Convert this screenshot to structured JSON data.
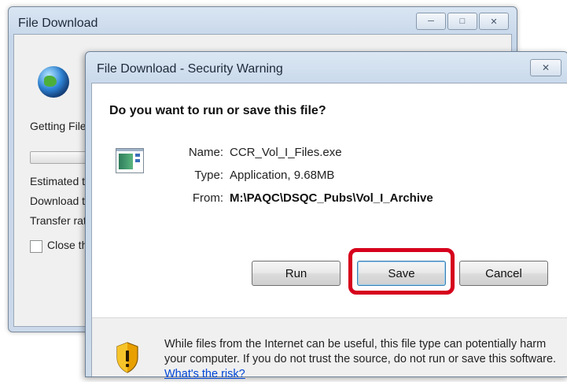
{
  "back_window": {
    "title": "File Download",
    "status_text": "Getting File",
    "estimated_label": "Estimated t",
    "download_label": "Download t",
    "transfer_label": "Transfer rat",
    "close_checkbox_label": "Close th"
  },
  "dialog": {
    "title": "File Download - Security Warning",
    "question": "Do you want to run or save this file?",
    "name_label": "Name:",
    "name_value": "CCR_Vol_I_Files.exe",
    "type_label": "Type:",
    "type_value": "Application, 9.68MB",
    "from_label": "From:",
    "from_value": "M:\\PAQC\\DSQC_Pubs\\Vol_I_Archive",
    "buttons": {
      "run": "Run",
      "save": "Save",
      "cancel": "Cancel"
    },
    "warning_text": "While files from the Internet can be useful, this file type can potentially harm your computer. If you do not trust the source, do not run or save this software.",
    "risk_link": "What's the risk?"
  },
  "icons": {
    "minimize": "minimize-icon",
    "maximize": "maximize-icon",
    "close": "close-icon",
    "globe": "globe-icon",
    "file": "file-icon",
    "shield": "shield-warning-icon"
  },
  "colors": {
    "highlight": "#d6001c",
    "link": "#0046d5"
  }
}
